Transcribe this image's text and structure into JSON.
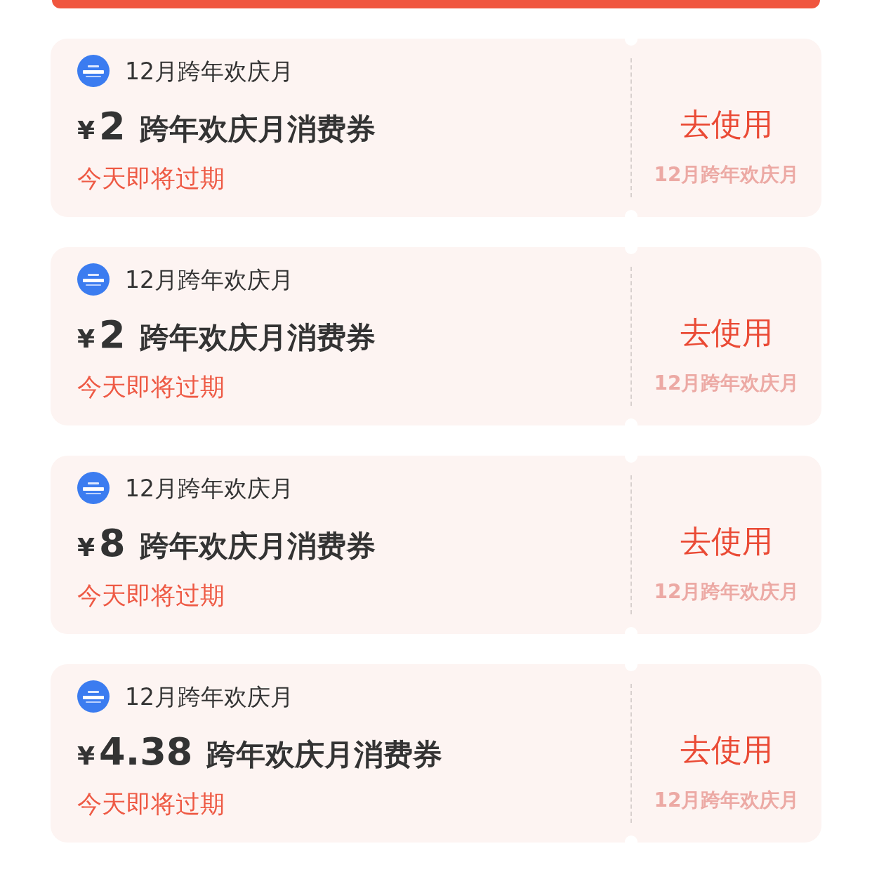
{
  "coupons": [
    {
      "brand": "12月跨年欢庆月",
      "currency": "¥",
      "amount": "2",
      "title": "跨年欢庆月消费券",
      "expiry": "今天即将过期",
      "action": "去使用",
      "stub_label": "12月跨年欢庆月"
    },
    {
      "brand": "12月跨年欢庆月",
      "currency": "¥",
      "amount": "2",
      "title": "跨年欢庆月消费券",
      "expiry": "今天即将过期",
      "action": "去使用",
      "stub_label": "12月跨年欢庆月"
    },
    {
      "brand": "12月跨年欢庆月",
      "currency": "¥",
      "amount": "8",
      "title": "跨年欢庆月消费券",
      "expiry": "今天即将过期",
      "action": "去使用",
      "stub_label": "12月跨年欢庆月"
    },
    {
      "brand": "12月跨年欢庆月",
      "currency": "¥",
      "amount": "4.38",
      "title": "跨年欢庆月消费券",
      "expiry": "今天即将过期",
      "action": "去使用",
      "stub_label": "12月跨年欢庆月"
    }
  ]
}
